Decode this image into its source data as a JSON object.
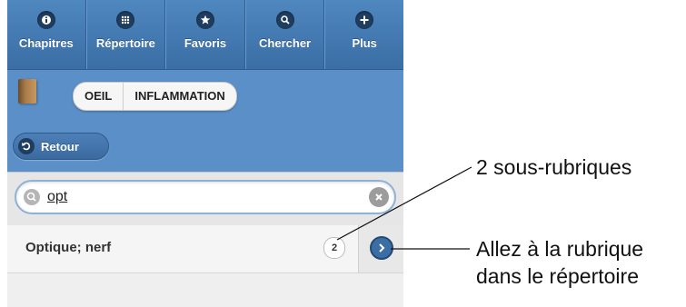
{
  "navbar": {
    "items": [
      {
        "label": "Chapitres",
        "icon": "info-icon"
      },
      {
        "label": "Répertoire",
        "icon": "grid-icon"
      },
      {
        "label": "Favoris",
        "icon": "star-icon"
      },
      {
        "label": "Chercher",
        "icon": "search-icon"
      },
      {
        "label": "Plus",
        "icon": "plus-icon"
      }
    ]
  },
  "breadcrumb": {
    "items": [
      "OEIL",
      "INFLAMMATION"
    ]
  },
  "back_button": {
    "label": "Retour"
  },
  "search": {
    "value": "opt"
  },
  "results": [
    {
      "label": "Optique; nerf",
      "count": "2"
    }
  ],
  "annotations": {
    "subrubrics": "2 sous-rubriques",
    "goto_line1": "Allez à la rubrique",
    "goto_line2": "dans le répertoire"
  },
  "colors": {
    "navbar": "#3a6ea5",
    "header": "#5b8fc7",
    "accent": "#3a6ea5"
  }
}
